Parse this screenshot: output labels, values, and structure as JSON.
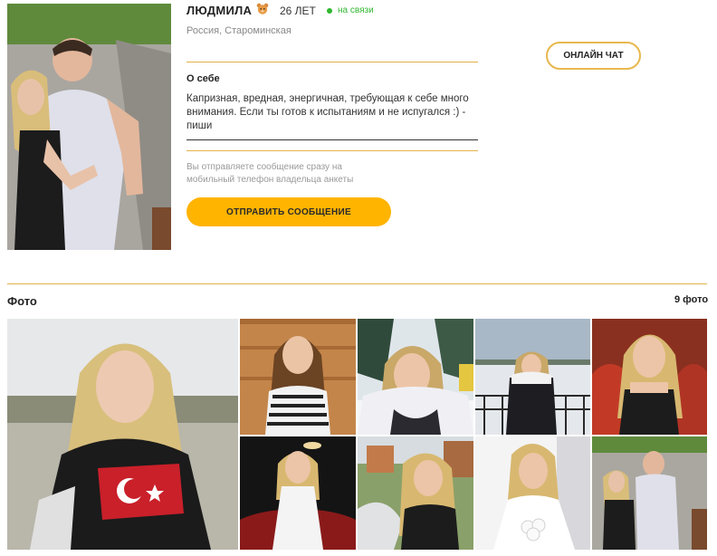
{
  "profile": {
    "name": "ЛЮДМИЛА",
    "age": "26 ЛЕТ",
    "status": "на связи",
    "location": "Россия, Староминская"
  },
  "about": {
    "title": "О себе",
    "text": "Капризная, вредная, энергичная, требующая к себе много внимания. Если ты готов к испытаниям и не испугался :) - пиши"
  },
  "messaging": {
    "notice": "Вы отправляете сообщение сразу на мобильный телефон владельца анкеты",
    "send_label": "ОТПРАВИТЬ СООБЩЕНИЕ",
    "chat_label": "ОНЛАЙН ЧАТ"
  },
  "photos": {
    "title": "Фото",
    "count": "9 фото"
  },
  "colors": {
    "accent": "#ffb400",
    "divider": "#e2b24a",
    "online": "#2fb72f"
  },
  "icons": {
    "zodiac": "bear-icon",
    "online": "online-dot-icon"
  }
}
